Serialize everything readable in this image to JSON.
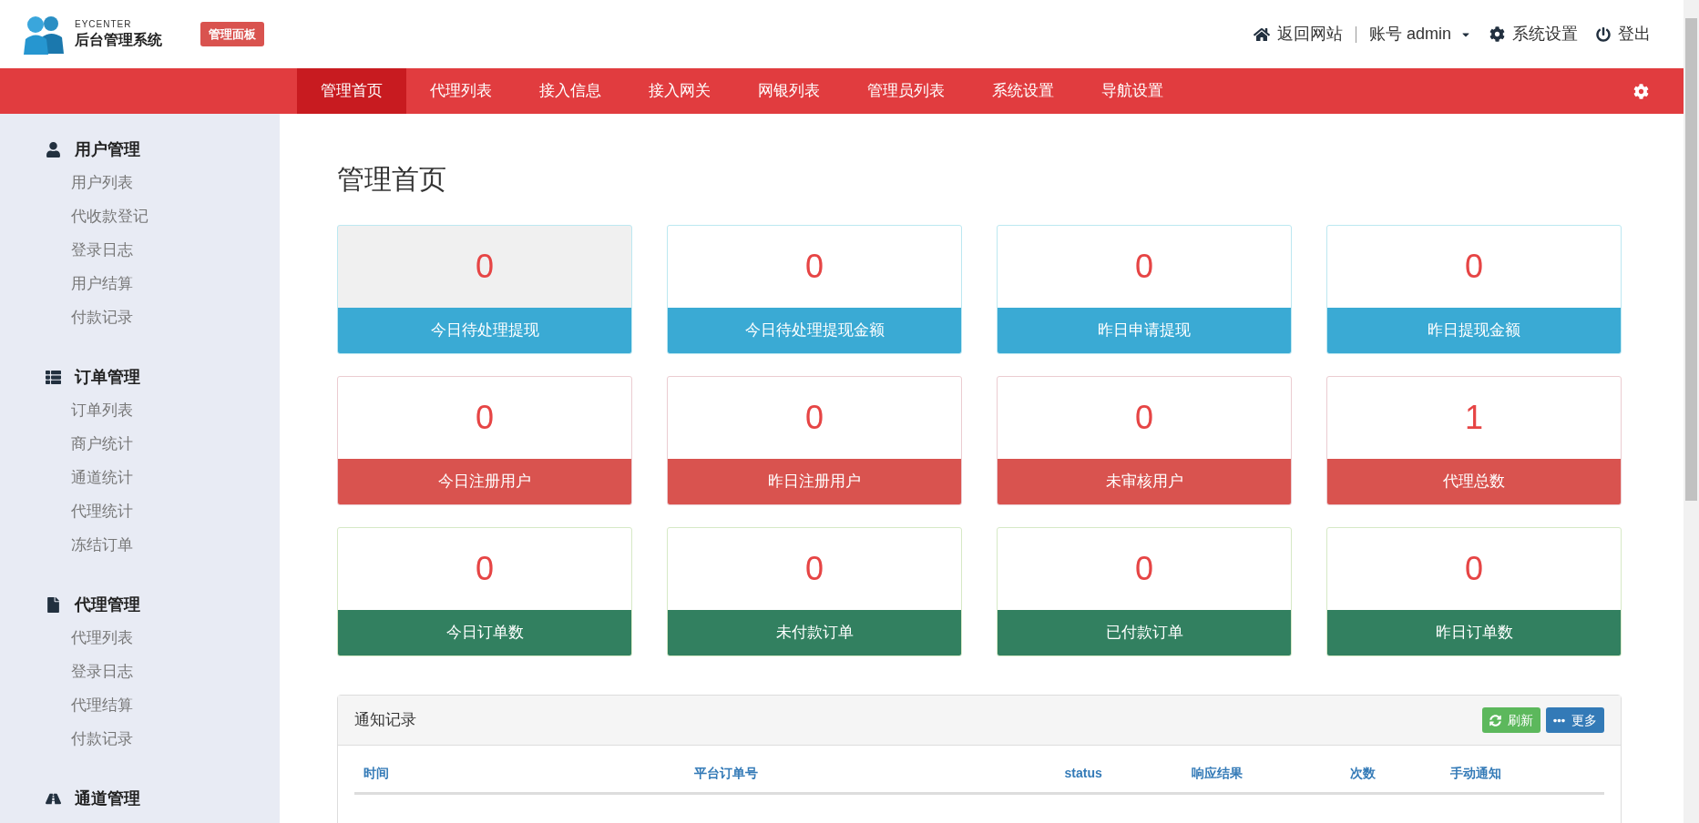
{
  "brand": {
    "subtitle": "EYCENTER",
    "title": "后台管理系统",
    "badge": "管理面板"
  },
  "top_links": [
    {
      "kind": "home",
      "label": "返回网站"
    },
    {
      "kind": "account",
      "label": "账号 admin"
    },
    {
      "kind": "settings",
      "label": "系统设置"
    },
    {
      "kind": "logout",
      "label": "登出"
    }
  ],
  "nav": [
    {
      "label": "管理首页",
      "selected": true
    },
    {
      "label": "代理列表",
      "selected": false
    },
    {
      "label": "接入信息",
      "selected": false
    },
    {
      "label": "接入网关",
      "selected": false
    },
    {
      "label": "网银列表",
      "selected": false
    },
    {
      "label": "管理员列表",
      "selected": false
    },
    {
      "label": "系统设置",
      "selected": false
    },
    {
      "label": "导航设置",
      "selected": false
    }
  ],
  "sidebar": [
    {
      "kind": "user",
      "title": "用户管理",
      "items": [
        "用户列表",
        "代收款登记",
        "登录日志",
        "用户结算",
        "付款记录"
      ]
    },
    {
      "kind": "list",
      "title": "订单管理",
      "items": [
        "订单列表",
        "商户统计",
        "通道统计",
        "代理统计",
        "冻结订单"
      ]
    },
    {
      "kind": "file",
      "title": "代理管理",
      "items": [
        "代理列表",
        "登录日志",
        "代理结算",
        "付款记录"
      ]
    },
    {
      "kind": "road",
      "title": "通道管理"
    }
  ],
  "page_title": "管理首页",
  "cards": [
    {
      "kind": "info",
      "value": "0",
      "label": "今日待处理提现",
      "highlighted": true
    },
    {
      "kind": "info",
      "value": "0",
      "label": "今日待处理提现金额",
      "highlighted": false
    },
    {
      "kind": "info",
      "value": "0",
      "label": "昨日申请提现",
      "highlighted": false
    },
    {
      "kind": "info",
      "value": "0",
      "label": "昨日提现金额",
      "highlighted": false
    },
    {
      "kind": "danger",
      "value": "0",
      "label": "今日注册用户",
      "highlighted": false
    },
    {
      "kind": "danger",
      "value": "0",
      "label": "昨日注册用户",
      "highlighted": false
    },
    {
      "kind": "danger",
      "value": "0",
      "label": "未审核用户",
      "highlighted": false
    },
    {
      "kind": "danger",
      "value": "1",
      "label": "代理总数",
      "highlighted": false
    },
    {
      "kind": "success",
      "value": "0",
      "label": "今日订单数",
      "highlighted": false
    },
    {
      "kind": "success",
      "value": "0",
      "label": "未付款订单",
      "highlighted": false
    },
    {
      "kind": "success",
      "value": "0",
      "label": "已付款订单",
      "highlighted": false
    },
    {
      "kind": "success",
      "value": "0",
      "label": "昨日订单数",
      "highlighted": false
    }
  ],
  "panel": {
    "title": "通知记录",
    "buttons": [
      {
        "kind": "refresh",
        "label": "刷新"
      },
      {
        "kind": "more",
        "label": "更多"
      }
    ],
    "columns": [
      "时间",
      "平台订单号",
      "status",
      "响应结果",
      "次数",
      "手动通知"
    ]
  }
}
